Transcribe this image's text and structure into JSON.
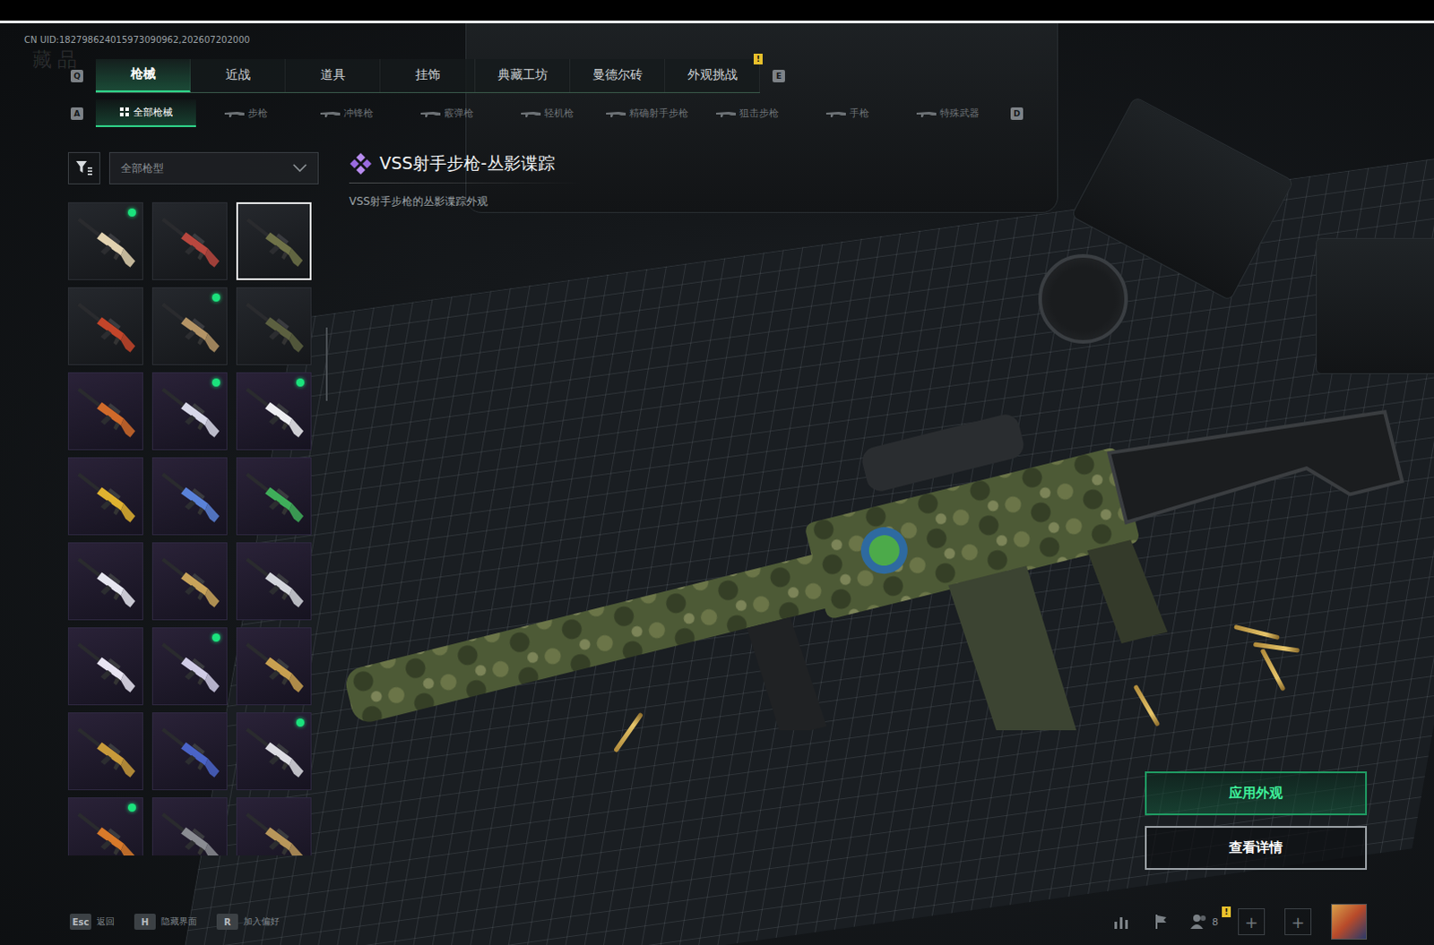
{
  "uid": "CN UID:182798624015973090962,202607202000",
  "watermark": "藏品",
  "tabs": {
    "prev_key": "Q",
    "next_key": "E",
    "items": [
      {
        "label": "枪械",
        "selected": true
      },
      {
        "label": "近战",
        "selected": false
      },
      {
        "label": "道具",
        "selected": false
      },
      {
        "label": "挂饰",
        "selected": false
      },
      {
        "label": "典藏工坊",
        "selected": false
      },
      {
        "label": "曼德尔砖",
        "selected": false
      },
      {
        "label": "外观挑战",
        "selected": false,
        "badge": "!"
      }
    ]
  },
  "subtabs": {
    "prev_key": "A",
    "next_key": "D",
    "items": [
      {
        "label": "全部枪械",
        "selected": true
      },
      {
        "label": "步枪",
        "selected": false
      },
      {
        "label": "冲锋枪",
        "selected": false
      },
      {
        "label": "霰弹枪",
        "selected": false
      },
      {
        "label": "轻机枪",
        "selected": false
      },
      {
        "label": "精确射手步枪",
        "selected": false
      },
      {
        "label": "狙击步枪",
        "selected": false
      },
      {
        "label": "手枪",
        "selected": false
      },
      {
        "label": "特殊武器",
        "selected": false
      }
    ]
  },
  "filter": {
    "label": "全部枪型"
  },
  "skins": [
    {
      "color": "#e2d2b0",
      "kind": "plain",
      "marked": true,
      "selected": false
    },
    {
      "color": "#b8473e",
      "kind": "plain",
      "marked": false,
      "selected": false
    },
    {
      "color": "#6f7248",
      "kind": "plain",
      "marked": false,
      "selected": true
    },
    {
      "color": "#c4452a",
      "kind": "plain",
      "marked": false,
      "selected": false
    },
    {
      "color": "#b49466",
      "kind": "plain",
      "marked": true,
      "selected": false
    },
    {
      "color": "#5c6040",
      "kind": "plain",
      "marked": false,
      "selected": false
    },
    {
      "color": "#d06a2a",
      "kind": "purple",
      "marked": false,
      "selected": false
    },
    {
      "color": "#d8d8e8",
      "kind": "purple",
      "marked": true,
      "selected": false
    },
    {
      "color": "#eeeef2",
      "kind": "purple",
      "marked": true,
      "selected": false
    },
    {
      "color": "#e0b230",
      "kind": "purple",
      "marked": false,
      "selected": false
    },
    {
      "color": "#5a82d8",
      "kind": "purple",
      "marked": false,
      "selected": false
    },
    {
      "color": "#3fae5a",
      "kind": "purple",
      "marked": false,
      "selected": false
    },
    {
      "color": "#e6e6f0",
      "kind": "purple",
      "marked": false,
      "selected": false
    },
    {
      "color": "#c9a45a",
      "kind": "purple",
      "marked": false,
      "selected": false
    },
    {
      "color": "#d4d6dc",
      "kind": "purple",
      "marked": false,
      "selected": false
    },
    {
      "color": "#e8e4f2",
      "kind": "purple",
      "marked": false,
      "selected": false
    },
    {
      "color": "#d0cce6",
      "kind": "purple",
      "marked": true,
      "selected": false
    },
    {
      "color": "#c8a050",
      "kind": "purple",
      "marked": false,
      "selected": false
    },
    {
      "color": "#c89a3a",
      "kind": "purple",
      "marked": false,
      "selected": false
    },
    {
      "color": "#4a64c8",
      "kind": "purple",
      "marked": false,
      "selected": false
    },
    {
      "color": "#dcdce2",
      "kind": "purple",
      "marked": true,
      "selected": false
    },
    {
      "color": "#d87a2a",
      "kind": "purple",
      "marked": true,
      "selected": false
    },
    {
      "color": "#8a8c92",
      "kind": "purple",
      "marked": false,
      "selected": false
    },
    {
      "color": "#b8965a",
      "kind": "purple",
      "marked": false,
      "selected": false
    }
  ],
  "detail": {
    "title": "VSS射手步枪-丛影谍踪",
    "description": "VSS射手步枪的丛影谍踪外观"
  },
  "buttons": [
    {
      "label": "应用外观",
      "kind": "primary"
    },
    {
      "label": "查看详情",
      "kind": "secondary"
    }
  ],
  "hints": [
    {
      "key": "Esc",
      "label": "返回"
    },
    {
      "key": "H",
      "label": "隐藏界面"
    },
    {
      "key": "R",
      "label": "加入偏好"
    }
  ],
  "social": {
    "friends": "8",
    "badge": "!",
    "slots": [
      "+",
      "+"
    ]
  }
}
